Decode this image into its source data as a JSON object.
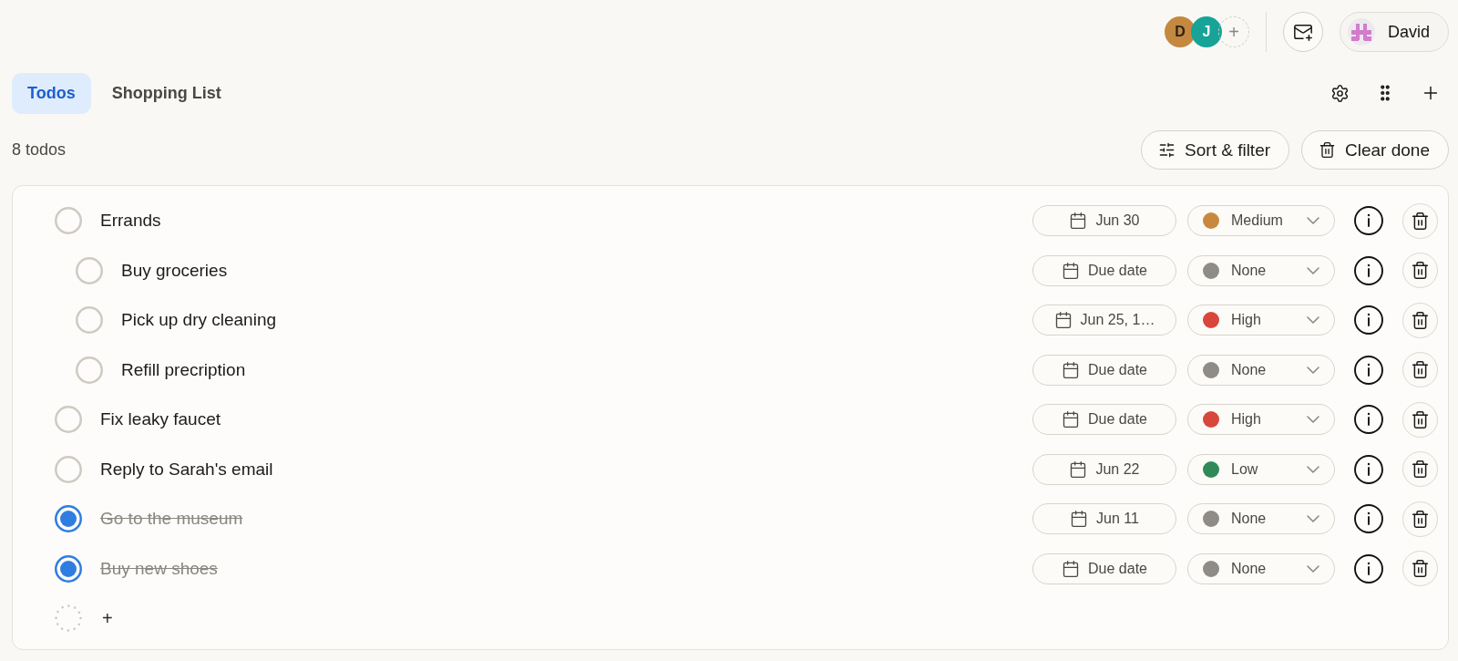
{
  "header": {
    "members": [
      {
        "initial": "D",
        "color": "#c4883f"
      },
      {
        "initial": "J",
        "color": "#17a398"
      }
    ],
    "add_member": "+",
    "user": {
      "name": "David"
    }
  },
  "tabs": [
    {
      "label": "Todos",
      "selected": true
    },
    {
      "label": "Shopping List",
      "selected": false
    }
  ],
  "summary": "8 todos",
  "actions": [
    {
      "kind": "filter",
      "label": "Sort & filter"
    },
    {
      "kind": "clear",
      "label": "Clear done"
    }
  ],
  "todos": [
    {
      "title": "Errands",
      "checked": false,
      "due": "Jun 30",
      "priority": {
        "label": "Medium",
        "color": "#c8893f"
      },
      "children": [
        {
          "title": "Buy groceries",
          "checked": false,
          "due": "Due date",
          "priority": {
            "label": "None",
            "color": "#8f8b86"
          }
        },
        {
          "title": "Pick up dry cleaning",
          "checked": false,
          "due": "Jun 25, 1…",
          "priority": {
            "label": "High",
            "color": "#d9463b"
          }
        },
        {
          "title": "Refill precription",
          "checked": false,
          "due": "Due date",
          "priority": {
            "label": "None",
            "color": "#8f8b86"
          }
        }
      ]
    },
    {
      "title": "Fix leaky faucet",
      "checked": false,
      "due": "Due date",
      "priority": {
        "label": "High",
        "color": "#d9463b"
      }
    },
    {
      "title": "Reply to Sarah's email",
      "checked": false,
      "due": "Jun 22",
      "priority": {
        "label": "Low",
        "color": "#2f8a58"
      }
    },
    {
      "title": "Go to the museum",
      "checked": true,
      "due": "Jun 11",
      "priority": {
        "label": "None",
        "color": "#8f8b86"
      }
    },
    {
      "title": "Buy new shoes",
      "checked": true,
      "due": "Due date",
      "priority": {
        "label": "None",
        "color": "#8f8b86"
      }
    }
  ],
  "new_item": {
    "label": "+"
  }
}
